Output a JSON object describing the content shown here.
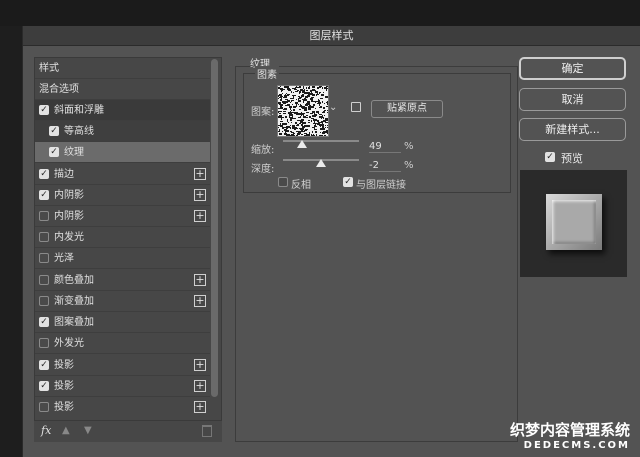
{
  "window": {
    "title": "图层样式"
  },
  "left_panel": {
    "items": [
      {
        "label": "样式",
        "has_checkbox": false,
        "checked": false,
        "has_plus": false
      },
      {
        "label": "混合选项",
        "has_checkbox": false,
        "checked": false,
        "has_plus": false
      },
      {
        "label": "斜面和浮雕",
        "has_checkbox": true,
        "checked": true,
        "has_plus": false
      },
      {
        "label": "等高线",
        "has_checkbox": true,
        "checked": true,
        "has_plus": false
      },
      {
        "label": "纹理",
        "has_checkbox": true,
        "checked": true,
        "has_plus": false
      },
      {
        "label": "描边",
        "has_checkbox": true,
        "checked": true,
        "has_plus": true
      },
      {
        "label": "内阴影",
        "has_checkbox": true,
        "checked": true,
        "has_plus": true
      },
      {
        "label": "内阴影",
        "has_checkbox": true,
        "checked": false,
        "has_plus": true
      },
      {
        "label": "内发光",
        "has_checkbox": true,
        "checked": false,
        "has_plus": false
      },
      {
        "label": "光泽",
        "has_checkbox": true,
        "checked": false,
        "has_plus": false
      },
      {
        "label": "颜色叠加",
        "has_checkbox": true,
        "checked": false,
        "has_plus": true
      },
      {
        "label": "渐变叠加",
        "has_checkbox": true,
        "checked": false,
        "has_plus": true
      },
      {
        "label": "图案叠加",
        "has_checkbox": true,
        "checked": true,
        "has_plus": false
      },
      {
        "label": "外发光",
        "has_checkbox": true,
        "checked": false,
        "has_plus": false
      },
      {
        "label": "投影",
        "has_checkbox": true,
        "checked": true,
        "has_plus": true
      },
      {
        "label": "投影",
        "has_checkbox": true,
        "checked": true,
        "has_plus": true
      },
      {
        "label": "投影",
        "has_checkbox": true,
        "checked": false,
        "has_plus": true
      }
    ],
    "fx_label": "fx"
  },
  "texture": {
    "section_title": "纹理",
    "group_title": "图素",
    "pattern_label": "图案:",
    "snap_button": "贴紧原点",
    "scale_label": "缩放:",
    "scale_value": "49",
    "scale_percent": 49,
    "depth_label": "深度:",
    "depth_value": "-2",
    "depth_percent": -2,
    "percent_sign": "%",
    "invert_label": "反相",
    "invert_checked": false,
    "link_label": "与图层链接",
    "link_checked": true
  },
  "right_panel": {
    "ok": "确定",
    "cancel": "取消",
    "new_style": "新建样式...",
    "preview_label": "预览",
    "preview_checked": true
  },
  "watermark": {
    "line1": "织梦内容管理系统",
    "line2": "DEDECMS.COM"
  },
  "colors": {
    "dialog_bg": "#535353",
    "panel_bg": "#474747",
    "selected_row": "#6b6b6b"
  }
}
